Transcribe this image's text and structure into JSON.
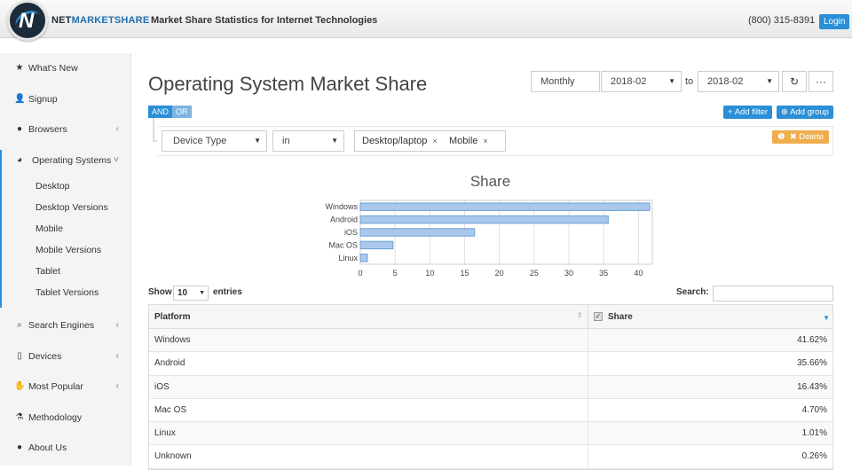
{
  "header": {
    "brand_net": "NET",
    "brand_mkt": "MARKETSHARE",
    "tagline": "Market Share Statistics for Internet Technologies",
    "phone": "(800) 315-8391",
    "login_label": "Login"
  },
  "sidebar": {
    "items": [
      {
        "label": "What's New",
        "icon": "star-icon"
      },
      {
        "label": "Signup",
        "icon": "user-plus-icon"
      },
      {
        "label": "Browsers",
        "icon": "globe-icon"
      },
      {
        "label": "Operating Systems",
        "icon": "pie-chart-icon"
      },
      {
        "label": "Search Engines",
        "icon": "search-icon"
      },
      {
        "label": "Devices",
        "icon": "tablet-icon"
      },
      {
        "label": "Most Popular",
        "icon": "thumbs-up-icon"
      },
      {
        "label": "Methodology",
        "icon": "flask-icon"
      },
      {
        "label": "About Us",
        "icon": "info-circle-icon"
      }
    ],
    "subitems": [
      "Desktop",
      "Desktop Versions",
      "Mobile",
      "Mobile Versions",
      "Tablet",
      "Tablet Versions"
    ]
  },
  "main": {
    "title": "Operating System Market Share",
    "period": "Monthly",
    "from_date": "2018-02",
    "to_label": "to",
    "to_date": "2018-02",
    "and_label": "AND",
    "or_label": "OR",
    "add_filter_label": "Add filter",
    "add_group_label": "Add group",
    "filter_field": "Device Type",
    "filter_operator": "in",
    "filter_values": [
      "Desktop/laptop",
      "Mobile"
    ],
    "delete_label": "Delete"
  },
  "chart_data": {
    "type": "bar",
    "orientation": "horizontal",
    "title": "Share",
    "categories": [
      "Windows",
      "Android",
      "iOS",
      "Mac OS",
      "Linux"
    ],
    "values": [
      41.62,
      35.66,
      16.43,
      4.7,
      1.01
    ],
    "xlim": [
      0,
      42
    ],
    "xticks": [
      0,
      5,
      10,
      15,
      20,
      25,
      30,
      35,
      40
    ],
    "grid": true,
    "bar_color": "#a9c8ec",
    "bar_border": "#6a9fd4"
  },
  "table": {
    "show_label": "Show",
    "page_size": "10",
    "entries_label": "entries",
    "search_label": "Search:",
    "columns": [
      "Platform",
      "Share"
    ],
    "rows": [
      {
        "platform": "Windows",
        "share": "41.62%"
      },
      {
        "platform": "Android",
        "share": "35.66%"
      },
      {
        "platform": "iOS",
        "share": "16.43%"
      },
      {
        "platform": "Mac OS",
        "share": "4.70%"
      },
      {
        "platform": "Linux",
        "share": "1.01%"
      },
      {
        "platform": "Unknown",
        "share": "0.26%"
      }
    ]
  },
  "colors": {
    "accent": "#2a8fd6",
    "warning": "#f0ad4e"
  }
}
